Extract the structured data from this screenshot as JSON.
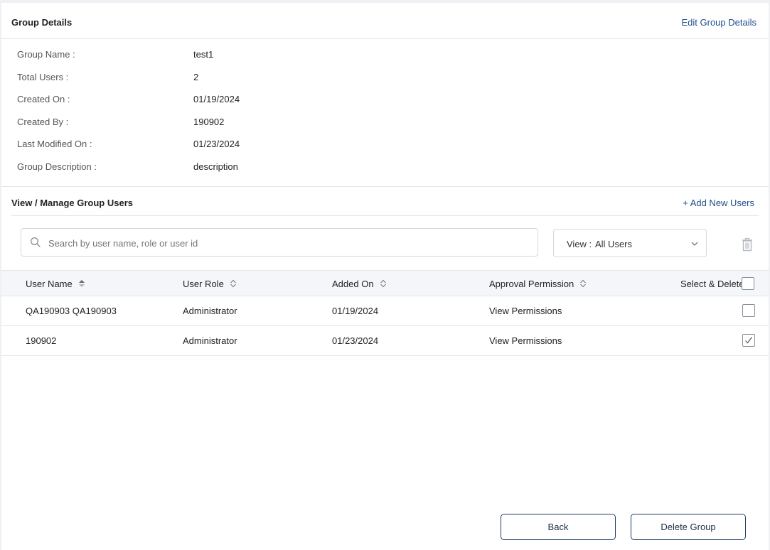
{
  "header": {
    "title": "Group Details",
    "edit_link": "Edit Group Details"
  },
  "details": [
    {
      "label": "Group Name :",
      "value": "test1"
    },
    {
      "label": "Total Users :",
      "value": "2"
    },
    {
      "label": "Created On :",
      "value": "01/19/2024"
    },
    {
      "label": "Created By :",
      "value": "190902"
    },
    {
      "label": "Last Modified On :",
      "value": "01/23/2024"
    },
    {
      "label": "Group Description :",
      "value": "description"
    }
  ],
  "users_section": {
    "title": "View / Manage Group Users",
    "add_link": "+ Add New Users"
  },
  "search": {
    "placeholder": "Search by user name, role or user id",
    "value": ""
  },
  "view_filter": {
    "label": "View :",
    "value": "All Users"
  },
  "table": {
    "columns": [
      "User Name",
      "User Role",
      "Added On",
      "Approval Permission",
      "Select & Delete"
    ],
    "rows": [
      {
        "user_name": "QA190903 QA190903",
        "role": "Administrator",
        "added_on": "01/19/2024",
        "permission_link": "View Permissions",
        "selected": false
      },
      {
        "user_name": "190902",
        "role": "Administrator",
        "added_on": "01/23/2024",
        "permission_link": "View Permissions",
        "selected": true
      }
    ]
  },
  "footer": {
    "back_label": "Back",
    "delete_group_label": "Delete Group"
  },
  "colors": {
    "link": "#1f4e8c",
    "table_header_bg": "#f4f6f9",
    "button_border": "#1f3b66"
  }
}
